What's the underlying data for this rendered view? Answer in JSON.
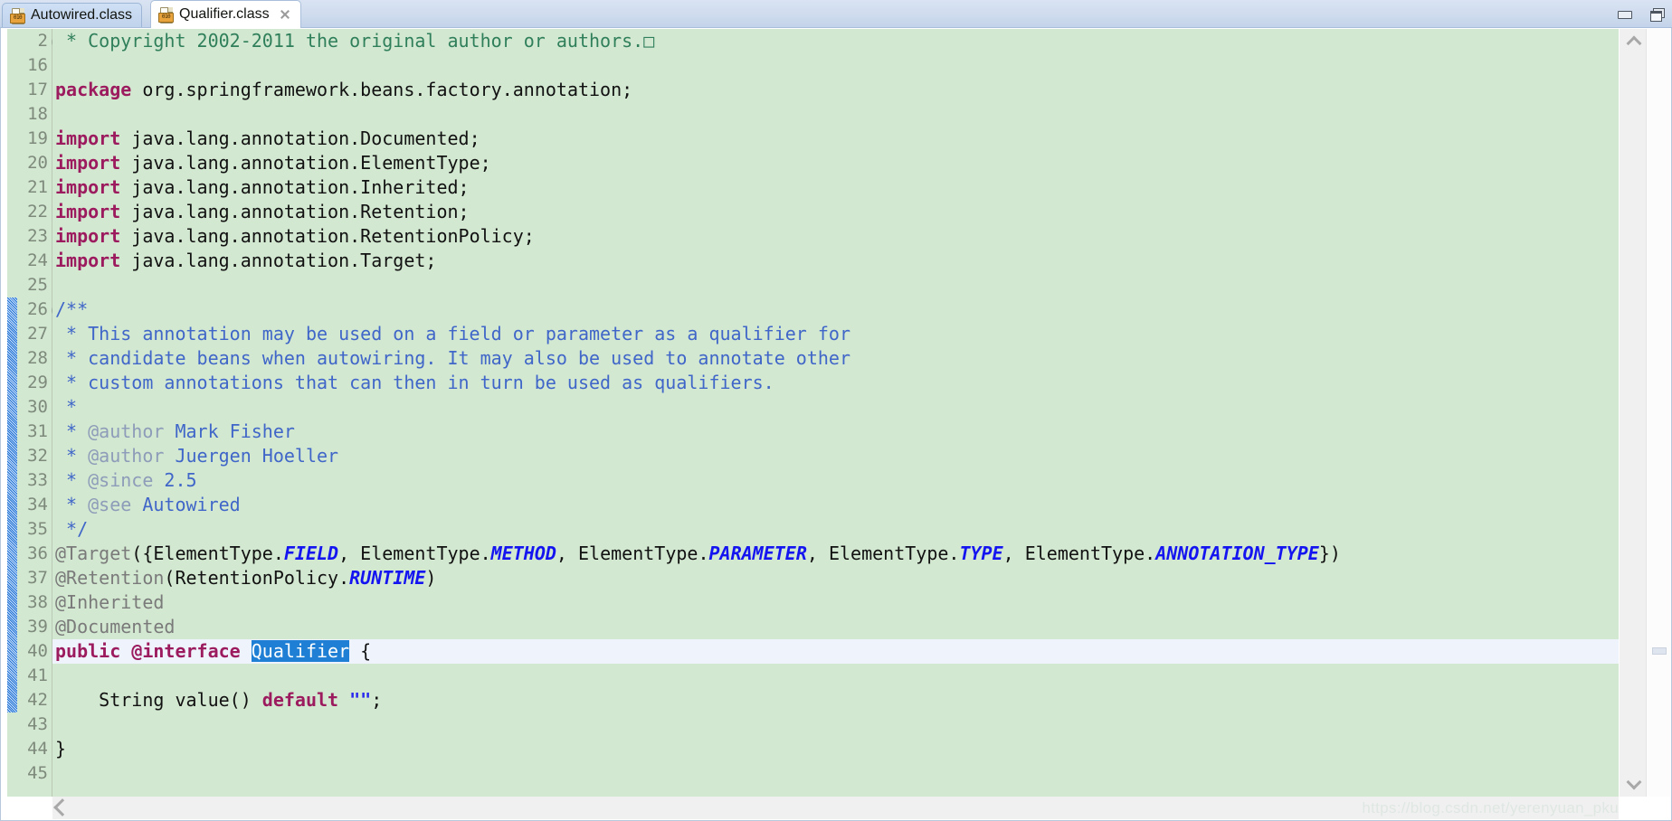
{
  "window": {
    "minimize_label": "Minimize",
    "maximize_label": "Restore",
    "minimize_icon": "window-minimize-icon",
    "maximize_icon": "window-restore-icon"
  },
  "tabs": [
    {
      "label": "Autowired.class",
      "icon": "class-file-icon",
      "active": false,
      "closable": false
    },
    {
      "label": "Qualifier.class",
      "icon": "class-file-icon",
      "active": true,
      "closable": true
    }
  ],
  "editor": {
    "file": "Qualifier.class",
    "current_line": 40,
    "selection_text": "Qualifier",
    "colors": {
      "code_background": "#d3e8d1",
      "current_line_background": "#eef3fc",
      "selection_background": "#1f7fd4",
      "keyword": "#9c1b5e",
      "javadoc": "#3f66c8",
      "javadoc_tag": "#8d9cb8",
      "annotation": "#7a7a7a",
      "constant": "#1414f0",
      "string": "#2a2aee",
      "line_number": "#7d8a7c",
      "fold_region_stripe": "#1c6fd0"
    },
    "fold_markers": [
      {
        "line": "2",
        "state": "collapsed"
      },
      {
        "line": "26",
        "state": "expanded"
      }
    ],
    "line_numbers": [
      "2",
      "16",
      "17",
      "18",
      "19",
      "20",
      "21",
      "22",
      "23",
      "24",
      "25",
      "26",
      "27",
      "28",
      "29",
      "30",
      "31",
      "32",
      "33",
      "34",
      "35",
      "36",
      "37",
      "38",
      "39",
      "40",
      "41",
      "42",
      "43",
      "44",
      "45"
    ],
    "lines": [
      {
        "n": "2",
        "text": " * Copyright 2002-2011 the original author or authors.",
        "tokens": [
          {
            "t": " * Copyright 2002-2011 the original author or authors.",
            "c": "cmt-dark"
          },
          {
            "t": "□",
            "c": "cmt-dark"
          }
        ]
      },
      {
        "n": "16",
        "text": "",
        "tokens": []
      },
      {
        "n": "17",
        "text": "package org.springframework.beans.factory.annotation;",
        "tokens": [
          {
            "t": "package",
            "c": "kw"
          },
          {
            "t": " org.springframework.beans.factory.annotation;",
            "c": "plain"
          }
        ]
      },
      {
        "n": "18",
        "text": "",
        "tokens": []
      },
      {
        "n": "19",
        "text": "import java.lang.annotation.Documented;",
        "tokens": [
          {
            "t": "import",
            "c": "kw"
          },
          {
            "t": " java.lang.annotation.Documented;",
            "c": "plain"
          }
        ]
      },
      {
        "n": "20",
        "text": "import java.lang.annotation.ElementType;",
        "tokens": [
          {
            "t": "import",
            "c": "kw"
          },
          {
            "t": " java.lang.annotation.ElementType;",
            "c": "plain"
          }
        ]
      },
      {
        "n": "21",
        "text": "import java.lang.annotation.Inherited;",
        "tokens": [
          {
            "t": "import",
            "c": "kw"
          },
          {
            "t": " java.lang.annotation.Inherited;",
            "c": "plain"
          }
        ]
      },
      {
        "n": "22",
        "text": "import java.lang.annotation.Retention;",
        "tokens": [
          {
            "t": "import",
            "c": "kw"
          },
          {
            "t": " java.lang.annotation.Retention;",
            "c": "plain"
          }
        ]
      },
      {
        "n": "23",
        "text": "import java.lang.annotation.RetentionPolicy;",
        "tokens": [
          {
            "t": "import",
            "c": "kw"
          },
          {
            "t": " java.lang.annotation.RetentionPolicy;",
            "c": "plain"
          }
        ]
      },
      {
        "n": "24",
        "text": "import java.lang.annotation.Target;",
        "tokens": [
          {
            "t": "import",
            "c": "kw"
          },
          {
            "t": " java.lang.annotation.Target;",
            "c": "plain"
          }
        ]
      },
      {
        "n": "25",
        "text": "",
        "tokens": []
      },
      {
        "n": "26",
        "text": "/**",
        "tokens": [
          {
            "t": "/**",
            "c": "jdoc"
          }
        ]
      },
      {
        "n": "27",
        "text": " * This annotation may be used on a field or parameter as a qualifier for",
        "tokens": [
          {
            "t": " * This annotation may be used on a field or parameter as a qualifier for",
            "c": "jdoc"
          }
        ]
      },
      {
        "n": "28",
        "text": " * candidate beans when autowiring. It may also be used to annotate other",
        "tokens": [
          {
            "t": " * candidate beans when autowiring. It may also be used to annotate other",
            "c": "jdoc"
          }
        ]
      },
      {
        "n": "29",
        "text": " * custom annotations that can then in turn be used as qualifiers.",
        "tokens": [
          {
            "t": " * custom annotations that can then in turn be used as qualifiers.",
            "c": "jdoc"
          }
        ]
      },
      {
        "n": "30",
        "text": " *",
        "tokens": [
          {
            "t": " *",
            "c": "jdoc"
          }
        ]
      },
      {
        "n": "31",
        "text": " * @author Mark Fisher",
        "tokens": [
          {
            "t": " * ",
            "c": "jdoc"
          },
          {
            "t": "@author",
            "c": "jtag"
          },
          {
            "t": " Mark Fisher",
            "c": "jdoc"
          }
        ]
      },
      {
        "n": "32",
        "text": " * @author Juergen Hoeller",
        "tokens": [
          {
            "t": " * ",
            "c": "jdoc"
          },
          {
            "t": "@author",
            "c": "jtag"
          },
          {
            "t": " Juergen Hoeller",
            "c": "jdoc"
          }
        ]
      },
      {
        "n": "33",
        "text": " * @since 2.5",
        "tokens": [
          {
            "t": " * ",
            "c": "jdoc"
          },
          {
            "t": "@since",
            "c": "jtag"
          },
          {
            "t": " 2.5",
            "c": "jdoc"
          }
        ]
      },
      {
        "n": "34",
        "text": " * @see Autowired",
        "tokens": [
          {
            "t": " * ",
            "c": "jdoc"
          },
          {
            "t": "@see",
            "c": "jtag"
          },
          {
            "t": " Autowired",
            "c": "jdoc"
          }
        ]
      },
      {
        "n": "35",
        "text": " */",
        "tokens": [
          {
            "t": " */",
            "c": "jdoc"
          }
        ]
      },
      {
        "n": "36",
        "text": "@Target({ElementType.FIELD, ElementType.METHOD, ElementType.PARAMETER, ElementType.TYPE, ElementType.ANNOTATION_TYPE})",
        "tokens": [
          {
            "t": "@Target",
            "c": "anno"
          },
          {
            "t": "({ElementType.",
            "c": "plain"
          },
          {
            "t": "FIELD",
            "c": "const"
          },
          {
            "t": ", ElementType.",
            "c": "plain"
          },
          {
            "t": "METHOD",
            "c": "const"
          },
          {
            "t": ", ElementType.",
            "c": "plain"
          },
          {
            "t": "PARAMETER",
            "c": "const"
          },
          {
            "t": ", ElementType.",
            "c": "plain"
          },
          {
            "t": "TYPE",
            "c": "const"
          },
          {
            "t": ", ElementType.",
            "c": "plain"
          },
          {
            "t": "ANNOTATION_TYPE",
            "c": "const"
          },
          {
            "t": "})",
            "c": "plain"
          }
        ]
      },
      {
        "n": "37",
        "text": "@Retention(RetentionPolicy.RUNTIME)",
        "tokens": [
          {
            "t": "@Retention",
            "c": "anno"
          },
          {
            "t": "(RetentionPolicy.",
            "c": "plain"
          },
          {
            "t": "RUNTIME",
            "c": "const"
          },
          {
            "t": ")",
            "c": "plain"
          }
        ]
      },
      {
        "n": "38",
        "text": "@Inherited",
        "tokens": [
          {
            "t": "@Inherited",
            "c": "anno"
          }
        ]
      },
      {
        "n": "39",
        "text": "@Documented",
        "tokens": [
          {
            "t": "@Documented",
            "c": "anno"
          }
        ]
      },
      {
        "n": "40",
        "text": "public @interface Qualifier {",
        "current": true,
        "tokens": [
          {
            "t": "public",
            "c": "kw"
          },
          {
            "t": " ",
            "c": "plain"
          },
          {
            "t": "@interface",
            "c": "kw"
          },
          {
            "t": " ",
            "c": "plain"
          },
          {
            "t": "Qualifier",
            "c": "sel"
          },
          {
            "t": " {",
            "c": "plain"
          }
        ]
      },
      {
        "n": "41",
        "text": "",
        "tokens": []
      },
      {
        "n": "42",
        "text": "    String value() default \"\";",
        "tokens": [
          {
            "t": "    String value() ",
            "c": "plain"
          },
          {
            "t": "default",
            "c": "kw"
          },
          {
            "t": " ",
            "c": "plain"
          },
          {
            "t": "\"\"",
            "c": "str"
          },
          {
            "t": ";",
            "c": "plain"
          }
        ]
      },
      {
        "n": "43",
        "text": "",
        "tokens": []
      },
      {
        "n": "44",
        "text": "}",
        "tokens": [
          {
            "t": "}",
            "c": "plain"
          }
        ]
      },
      {
        "n": "45",
        "text": "",
        "tokens": []
      }
    ]
  },
  "scrollbars": {
    "vertical": {
      "up_icon": "chevron-up-icon",
      "down_icon": "chevron-down-icon"
    },
    "horizontal": {
      "left_icon": "chevron-left-icon"
    }
  },
  "watermark": {
    "text": "https://blog.csdn.net/yerenyuan_pku"
  }
}
